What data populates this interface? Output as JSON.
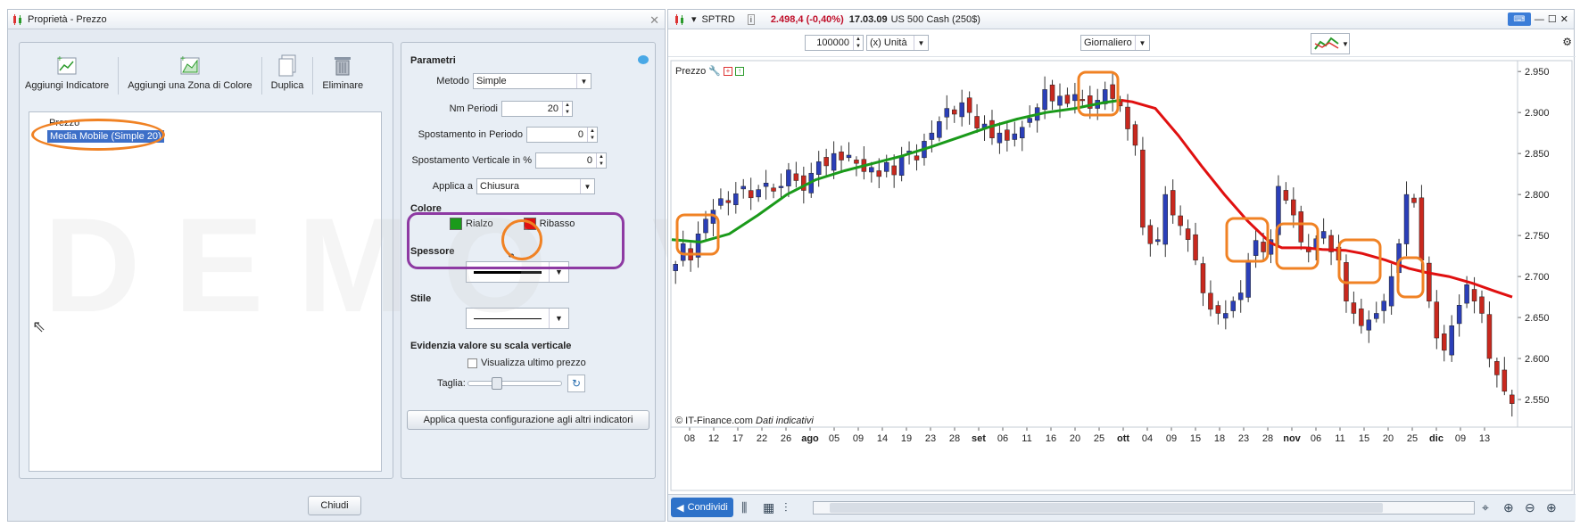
{
  "dialog": {
    "title": "Proprietà - Prezzo",
    "toolbar": {
      "add_indicator": "Aggiungi Indicatore",
      "add_color_zone": "Aggiungi una Zona di Colore",
      "duplicate": "Duplica",
      "delete": "Eliminare"
    },
    "tree": {
      "items": [
        "Prezzo",
        "Media Mobile (Simple 20)"
      ]
    },
    "params": {
      "title": "Parametri",
      "method_label": "Metodo",
      "method_value": "Simple",
      "periods_label": "Nm Periodi",
      "periods_value": "20",
      "period_shift_label": "Spostamento in Periodo",
      "period_shift_value": "0",
      "vertical_shift_label": "Spostamento Verticale in %",
      "vertical_shift_value": "0",
      "apply_to_label": "Applica a",
      "apply_to_value": "Chiusura",
      "color_title": "Colore",
      "up_label": "Rialzo",
      "down_label": "Ribasso",
      "up_color": "#1a9a1a",
      "down_color": "#e01010",
      "thickness_title": "Spessore",
      "style_title": "Stile",
      "highlight_title": "Evidenzia valore su scala verticale",
      "show_last_price": "Visualizza ultimo prezzo",
      "size_label": "Taglia:",
      "apply_all": "Applica questa configurazione agli altri indicatori"
    },
    "close_button": "Chiudi",
    "watermark": "DEMO VERSION"
  },
  "chart_window": {
    "symbol": "SPTRD",
    "price_change": "2.498,4 (-0,40%)",
    "date": "17.03.09",
    "instrument": "US 500 Cash (250$)",
    "quantity": "100000",
    "unit": "(x) Unità",
    "timeframe": "Giornaliero",
    "series_label": "Prezzo",
    "footer_copyright": "© IT-Finance.com",
    "footer_note": "Dati indicativi",
    "share_button": "Condividi",
    "accent": "#2e72c9"
  },
  "chart_data": {
    "type": "candlestick",
    "y_ticks": [
      2.95,
      2.9,
      2.85,
      2.8,
      2.75,
      2.7,
      2.65,
      2.6,
      2.55
    ],
    "y_tick_labels": [
      "2.950",
      "2.900",
      "2.850",
      "2.800",
      "2.750",
      "2.700",
      "2.650",
      "2.600",
      "2.550"
    ],
    "ylim": [
      2.525,
      2.96
    ],
    "x_tick_labels": [
      "08",
      "12",
      "17",
      "22",
      "26",
      "ago",
      "05",
      "09",
      "14",
      "19",
      "23",
      "28",
      "set",
      "06",
      "11",
      "16",
      "20",
      "25",
      "ott",
      "04",
      "09",
      "15",
      "18",
      "23",
      "28",
      "nov",
      "06",
      "11",
      "15",
      "20",
      "25",
      "dic",
      "09",
      "13"
    ],
    "x_tick_bold": [
      "ago",
      "set",
      "ott",
      "nov",
      "dic"
    ],
    "candle_count": 112,
    "closes": [
      2.715,
      2.74,
      2.72,
      2.752,
      2.77,
      2.781,
      2.795,
      2.79,
      2.801,
      2.81,
      2.796,
      2.806,
      2.814,
      2.804,
      2.81,
      2.83,
      2.817,
      2.805,
      2.826,
      2.84,
      2.835,
      2.85,
      2.842,
      2.848,
      2.838,
      2.828,
      2.833,
      2.822,
      2.839,
      2.824,
      2.846,
      2.853,
      2.842,
      2.865,
      2.875,
      2.889,
      2.905,
      2.898,
      2.912,
      2.9,
      2.881,
      2.886,
      2.869,
      2.875,
      2.866,
      2.874,
      2.882,
      2.893,
      2.906,
      2.928,
      2.914,
      2.92,
      2.911,
      2.922,
      2.916,
      2.905,
      2.915,
      2.928,
      2.917,
      2.908,
      2.88,
      2.86,
      2.76,
      2.74,
      2.745,
      2.8,
      2.775,
      2.762,
      2.745,
      2.72,
      2.68,
      2.66,
      2.655,
      2.655,
      2.67,
      2.68,
      2.72,
      2.744,
      2.73,
      2.745,
      2.81,
      2.793,
      2.775,
      2.742,
      2.73,
      2.746,
      2.755,
      2.73,
      2.72,
      2.67,
      2.655,
      2.64,
      2.647,
      2.655,
      2.67,
      2.7,
      2.74,
      2.8,
      2.79,
      2.72,
      2.67,
      2.625,
      2.61,
      2.64,
      2.665,
      2.69,
      2.67,
      2.655,
      2.6,
      2.58,
      2.56,
      2.545
    ],
    "ma": {
      "name": "Media Mobile (Simple 20)",
      "points": [
        [
          0,
          2.745
        ],
        [
          5,
          2.742
        ],
        [
          10,
          2.752
        ],
        [
          15,
          2.775
        ],
        [
          20,
          2.8
        ],
        [
          25,
          2.818
        ],
        [
          30,
          2.829
        ],
        [
          35,
          2.838
        ],
        [
          40,
          2.847
        ],
        [
          45,
          2.858
        ],
        [
          50,
          2.87
        ],
        [
          55,
          2.882
        ],
        [
          60,
          2.892
        ],
        [
          65,
          2.9
        ],
        [
          70,
          2.905
        ],
        [
          75,
          2.912
        ],
        [
          78,
          2.915
        ],
        [
          80,
          2.913
        ],
        [
          84,
          2.905
        ],
        [
          88,
          2.872
        ],
        [
          92,
          2.835
        ],
        [
          96,
          2.8
        ],
        [
          100,
          2.768
        ],
        [
          104,
          2.741
        ],
        [
          106,
          2.735
        ],
        [
          110,
          2.735
        ],
        [
          113,
          2.733
        ],
        [
          117,
          2.732
        ],
        [
          120,
          2.728
        ],
        [
          124,
          2.72
        ],
        [
          128,
          2.71
        ],
        [
          131,
          2.705
        ],
        [
          135,
          2.7
        ],
        [
          139,
          2.692
        ],
        [
          143,
          2.682
        ],
        [
          146,
          2.675
        ]
      ],
      "up_color": "#1a9a1a",
      "down_color": "#e01010",
      "turn_index": 78
    }
  }
}
